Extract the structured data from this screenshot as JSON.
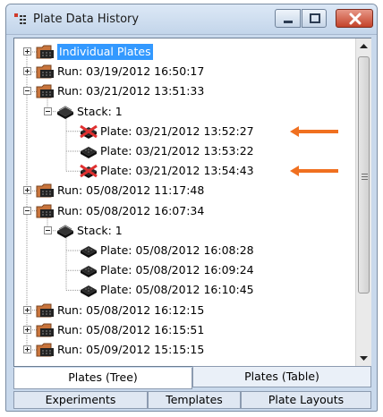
{
  "window": {
    "title": "Plate Data History"
  },
  "tree": {
    "nodes": [
      {
        "label": "Individual Plates",
        "selected": true
      },
      {
        "label": "Run: 03/19/2012 16:50:17"
      },
      {
        "label": "Run: 03/21/2012 13:51:33"
      },
      {
        "label": "Stack: 1"
      },
      {
        "label": "Plate: 03/21/2012 13:52:27",
        "marked": true
      },
      {
        "label": "Plate: 03/21/2012 13:53:22"
      },
      {
        "label": "Plate: 03/21/2012 13:54:43",
        "marked": true
      },
      {
        "label": "Run: 05/08/2012 11:17:48"
      },
      {
        "label": "Run: 05/08/2012 16:07:34"
      },
      {
        "label": "Stack: 1"
      },
      {
        "label": "Plate: 05/08/2012 16:08:28"
      },
      {
        "label": "Plate: 05/08/2012 16:09:24"
      },
      {
        "label": "Plate: 05/08/2012 16:10:45"
      },
      {
        "label": "Run: 05/08/2012 16:12:15"
      },
      {
        "label": "Run: 05/08/2012 16:15:51"
      },
      {
        "label": "Run: 05/09/2012 15:15:15"
      }
    ]
  },
  "tabs": {
    "upper": [
      {
        "label": "Plates (Tree)",
        "active": true
      },
      {
        "label": "Plates (Table)"
      }
    ],
    "lower": [
      {
        "label": "Experiments"
      },
      {
        "label": "Templates"
      },
      {
        "label": "Plate Layouts"
      }
    ]
  },
  "colors": {
    "selection": "#3399ff",
    "annotation_arrow": "#f07020",
    "deleted_mark": "#e03030"
  }
}
